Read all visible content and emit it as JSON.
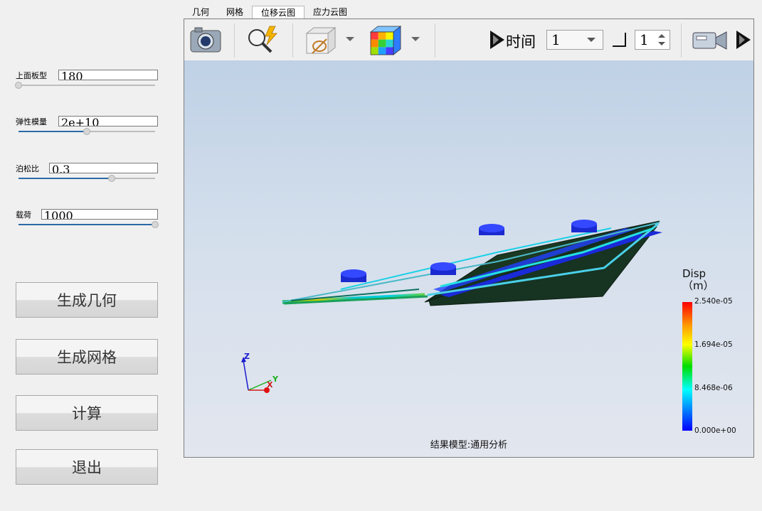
{
  "params": [
    {
      "label": "上面板型",
      "value": "180",
      "level": 0.0
    },
    {
      "label": "弹性模量",
      "value": "2e+10",
      "level": 0.5
    },
    {
      "label": "泊松比",
      "value": "0.3",
      "level": 0.68
    },
    {
      "label": "载荷",
      "value": "1000",
      "level": 1.0
    }
  ],
  "buttons": {
    "generate_geometry": "生成几何",
    "generate_mesh": "生成网格",
    "compute": "计算",
    "exit": "退出"
  },
  "tabs": [
    "几何",
    "网格",
    "位移云图",
    "应力云图"
  ],
  "active_tab": "位移云图",
  "toolbar": {
    "time_label": "时间",
    "time_value": "1",
    "step_value": "1"
  },
  "legend": {
    "title": "Disp",
    "unit": "（m）",
    "ticks": [
      "2.540e-05",
      "1.694e-05",
      "8.468e-06",
      "0.000e+00"
    ]
  },
  "axes": {
    "z": "Z",
    "y": "Y",
    "x": "X"
  },
  "model_label": "结果模型:通用分析",
  "colors": {
    "accent": "#2a6aa8",
    "model_blue": "#1a2ad8",
    "plate_dark": "#14301c"
  }
}
